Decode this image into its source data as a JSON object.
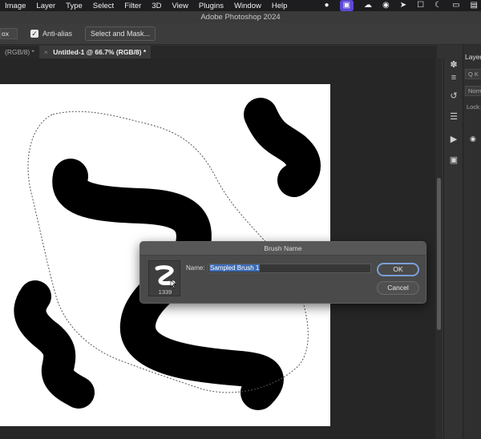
{
  "menubar": {
    "items": [
      "Image",
      "Layer",
      "Type",
      "Select",
      "Filter",
      "3D",
      "View",
      "Plugins",
      "Window",
      "Help"
    ],
    "status_icons": [
      "camera-icon",
      "screen-share-icon",
      "cloud-icon",
      "creative-cloud-icon",
      "cursor-icon",
      "lock-icon",
      "moon-icon",
      "window-icon",
      "control-center-icon"
    ]
  },
  "app": {
    "title": "Adobe Photoshop 2024"
  },
  "options": {
    "field_value": "ox",
    "anti_alias_label": "Anti-alias",
    "anti_alias_checked": true,
    "select_mask_label": "Select and Mask..."
  },
  "tabs": [
    {
      "label": "(RGB/8) *",
      "close": ""
    },
    {
      "label": "Untitled-1 @ 66.7% (RGB/8) *",
      "close": "×"
    }
  ],
  "dialog": {
    "title": "Brush Name",
    "brush_size": "1339",
    "name_label": "Name:",
    "name_value": "Sampled Brush 1",
    "ok_label": "OK",
    "cancel_label": "Cancel"
  },
  "panel": {
    "title": "Layers",
    "search_placeholder": "Q K",
    "blend_mode": "Normal",
    "lock_label": "Lock:"
  },
  "colors": {
    "accent": "#5a48d6",
    "selection": "#3d6bb3",
    "ok_border": "#7a9fd8"
  }
}
